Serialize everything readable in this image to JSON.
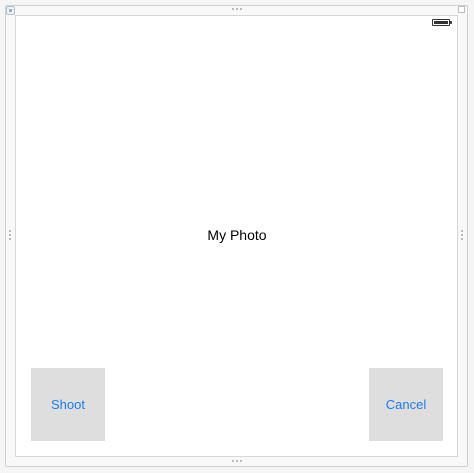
{
  "scene": {
    "photo_label": "My Photo"
  },
  "buttons": {
    "shoot_label": "Shoot",
    "cancel_label": "Cancel"
  },
  "status_bar": {
    "battery_icon": "battery-icon",
    "battery_level_percent": 100
  },
  "colors": {
    "button_text": "#1a7cf0",
    "button_background": "#dedede",
    "label_text": "#000000"
  }
}
